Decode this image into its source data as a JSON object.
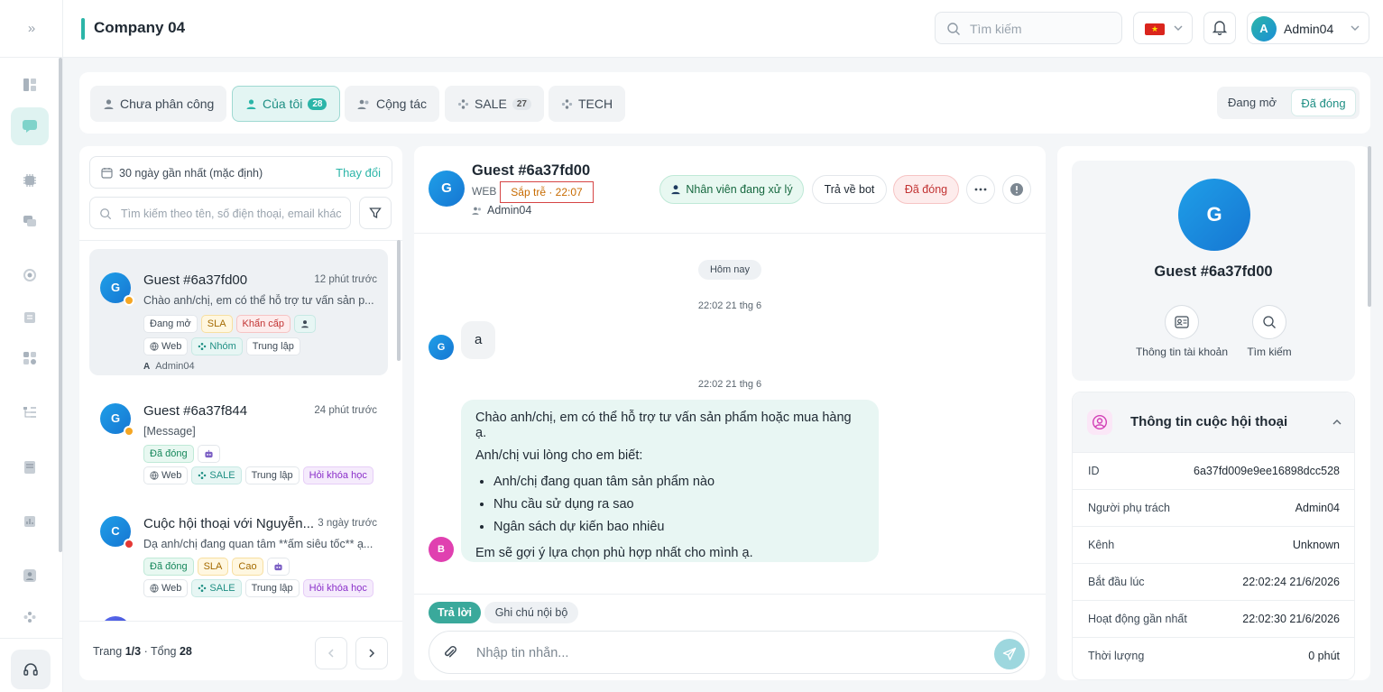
{
  "header": {
    "title": "Company 04",
    "search_placeholder": "Tìm kiếm",
    "user_initial": "A",
    "user_name": "Admin04"
  },
  "queue_tabs": [
    {
      "label": "Chưa phân công",
      "count": ""
    },
    {
      "label": "Của tôi",
      "count": "28"
    },
    {
      "label": "Cộng tác",
      "count": ""
    },
    {
      "label": "SALE",
      "count": "27"
    },
    {
      "label": "TECH",
      "count": ""
    }
  ],
  "status_toggle": {
    "open": "Đang mở",
    "closed": "Đã đóng"
  },
  "list": {
    "range_label": "30 ngày gần nhất (mặc định)",
    "range_change": "Thay đổi",
    "search_placeholder": "Tìm kiếm theo tên, số điện thoại, email khác",
    "items": [
      {
        "initial": "G",
        "name": "Guest #6a37fd00",
        "time": "12 phút trước",
        "preview": "Chào anh/chị, em có thể hỗ trợ tư vấn sản p...",
        "tags1": [
          "Đang mở",
          "SLA",
          "Khẩn cấp"
        ],
        "tags2": [
          "Web",
          "Nhóm",
          "Trung lập"
        ],
        "agent": "Admin04"
      },
      {
        "initial": "G",
        "name": "Guest #6a37f844",
        "time": "24 phút trước",
        "preview": "[Message]",
        "tags1": [
          "Đã đóng"
        ],
        "tags2": [
          "Web",
          "SALE",
          "Trung lập",
          "Hỏi khóa học"
        ]
      },
      {
        "initial": "C",
        "name": "Cuộc hội thoại với Nguyễn...",
        "time": "3 ngày trước",
        "preview": "Dạ anh/chị đang quan tâm **ấm siêu tốc** ạ...",
        "tags1": [
          "Đã đóng",
          "SLA",
          "Cao"
        ],
        "tags2": [
          "Web",
          "SALE",
          "Trung lập",
          "Hỏi khóa học"
        ]
      }
    ],
    "pagination": {
      "prefix": "Trang",
      "page": "1/3",
      "total_label": "Tổng",
      "total": "28"
    }
  },
  "chat": {
    "initial": "G",
    "name": "Guest #6a37fd00",
    "channel": "WEB",
    "late": "Sắp trễ · 22:07",
    "agent": "Admin04",
    "status_handling": "Nhân viên đang xử lý",
    "return_bot": "Trả về bot",
    "closed": "Đã đóng",
    "day_chip": "Hôm nay",
    "msg1_time": "22:02 21 thg 6",
    "msg1_text": "a",
    "msg2_time": "22:02 21 thg 6",
    "bot_initial": "B",
    "msg2_intro": "Chào anh/chị, em có thể hỗ trợ tư vấn sản phẩm hoặc mua hàng ạ.",
    "msg2_ask": "Anh/chị vui lòng cho em biết:",
    "msg2_points": [
      "Anh/chị đang quan tâm sản phẩm nào",
      "Nhu cầu sử dụng ra sao",
      "Ngân sách dự kiến bao nhiêu"
    ],
    "msg2_outro": "Em sẽ gợi ý lựa chọn phù hợp nhất cho mình ạ.",
    "reply_tab": "Trả lời",
    "note_tab": "Ghi chú nội bộ",
    "input_placeholder": "Nhập tin nhắn..."
  },
  "profile": {
    "initial": "G",
    "name": "Guest #6a37fd00",
    "action_account": "Thông tin tài khoản",
    "action_search": "Tìm kiếm",
    "info_title": "Thông tin cuộc hội thoại",
    "rows": [
      {
        "k": "ID",
        "v": "6a37fd009e9ee16898dcc528"
      },
      {
        "k": "Người phụ trách",
        "v": "Admin04"
      },
      {
        "k": "Kênh",
        "v": "Unknown"
      },
      {
        "k": "Bắt đầu lúc",
        "v": "22:02:24 21/6/2026"
      },
      {
        "k": "Hoạt động gần nhất",
        "v": "22:02:30 21/6/2026"
      },
      {
        "k": "Thời lượng",
        "v": "0 phút"
      }
    ]
  },
  "colors": {
    "accent": "#2bb5a8",
    "online_dot": "#f5a623",
    "danger_dot": "#e53935",
    "bot": "#e040b0"
  }
}
